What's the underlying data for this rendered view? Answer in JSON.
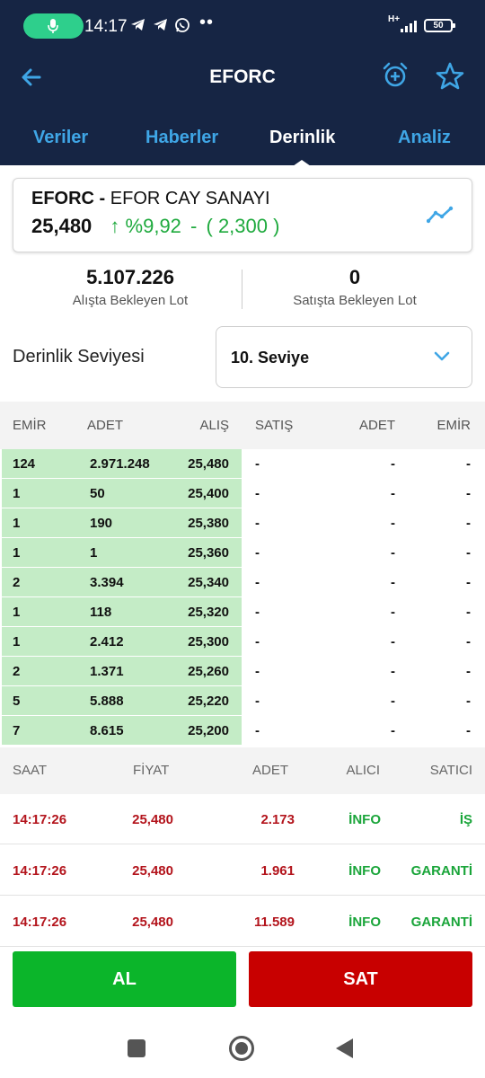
{
  "status_bar": {
    "time": "14:17",
    "network": "H+",
    "battery": "50",
    "more": "••"
  },
  "header": {
    "title": "EFORC"
  },
  "tabs": [
    {
      "label": "Veriler",
      "active": false
    },
    {
      "label": "Haberler",
      "active": false
    },
    {
      "label": "Derinlik",
      "active": true
    },
    {
      "label": "Analiz",
      "active": false
    }
  ],
  "stock": {
    "symbol": "EFORC -",
    "name": "EFOR CAY SANAYI",
    "price": "25,480",
    "change_percent": "↑ %9,92",
    "separator": "-",
    "change_abs": "( 2,300 )"
  },
  "lots": {
    "bid_value": "5.107.226",
    "bid_label": "Alışta Bekleyen Lot",
    "ask_value": "0",
    "ask_label": "Satışta Bekleyen Lot"
  },
  "depth_level": {
    "label": "Derinlik Seviyesi",
    "selected": "10. Seviye"
  },
  "depth_table": {
    "headers": [
      "EMİR",
      "ADET",
      "ALIŞ",
      "SATIŞ",
      "ADET",
      "EMİR"
    ],
    "rows": [
      [
        "124",
        "2.971.248",
        "25,480",
        "-",
        "-",
        "-"
      ],
      [
        "1",
        "50",
        "25,400",
        "-",
        "-",
        "-"
      ],
      [
        "1",
        "190",
        "25,380",
        "-",
        "-",
        "-"
      ],
      [
        "1",
        "1",
        "25,360",
        "-",
        "-",
        "-"
      ],
      [
        "2",
        "3.394",
        "25,340",
        "-",
        "-",
        "-"
      ],
      [
        "1",
        "118",
        "25,320",
        "-",
        "-",
        "-"
      ],
      [
        "1",
        "2.412",
        "25,300",
        "-",
        "-",
        "-"
      ],
      [
        "2",
        "1.371",
        "25,260",
        "-",
        "-",
        "-"
      ],
      [
        "5",
        "5.888",
        "25,220",
        "-",
        "-",
        "-"
      ],
      [
        "7",
        "8.615",
        "25,200",
        "-",
        "-",
        "-"
      ]
    ]
  },
  "trades": {
    "headers": [
      "SAAT",
      "FİYAT",
      "ADET",
      "ALICI",
      "SATICI"
    ],
    "rows": [
      [
        "14:17:26",
        "25,480",
        "2.173",
        "İNFO",
        "İŞ"
      ],
      [
        "14:17:26",
        "25,480",
        "1.961",
        "İNFO",
        "GARANTİ"
      ],
      [
        "14:17:26",
        "25,480",
        "11.589",
        "İNFO",
        "GARANTİ"
      ]
    ]
  },
  "actions": {
    "buy": "AL",
    "sell": "SAT"
  },
  "colors": {
    "header_bg": "#162544",
    "tab_inactive": "#3fa6e6",
    "positive": "#1faa3e",
    "bid_row_bg": "#c4ecc6",
    "trade_red": "#b3141c",
    "buy_button": "#0bb52a",
    "sell_button": "#c80000"
  },
  "icons": [
    "mic-icon",
    "telegram-icon",
    "whatsapp-icon",
    "signal-icon",
    "battery-icon",
    "back-arrow-icon",
    "alarm-add-icon",
    "star-icon",
    "chart-line-icon",
    "chevron-down-icon",
    "nav-recents-icon",
    "nav-home-icon",
    "nav-back-icon"
  ]
}
